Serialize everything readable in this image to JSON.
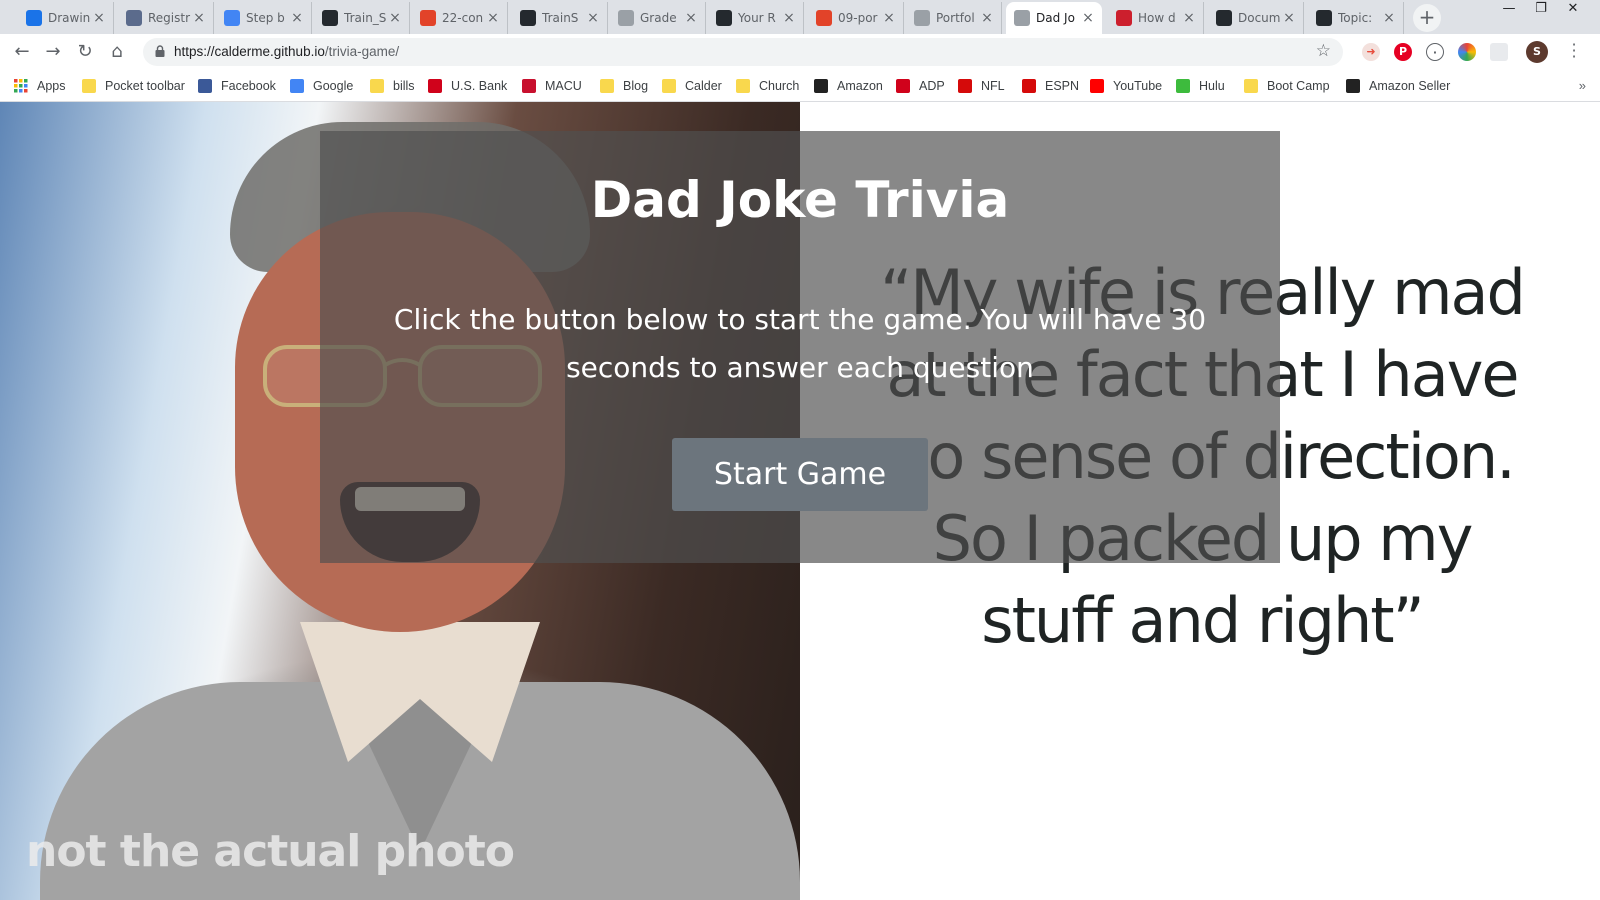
{
  "browser": {
    "tabs": [
      {
        "title": "Drawing",
        "icon": "loading-spinner-icon",
        "color": "#1a73e8"
      },
      {
        "title": "Registr",
        "icon": "form-icon",
        "color": "#5b6b8c"
      },
      {
        "title": "Step b",
        "icon": "google-docs-icon",
        "color": "#4285f4"
      },
      {
        "title": "Train_S",
        "icon": "github-icon",
        "color": "#24292e"
      },
      {
        "title": "22-con",
        "icon": "gitlab-icon",
        "color": "#e24329"
      },
      {
        "title": "TrainS",
        "icon": "github-icon",
        "color": "#24292e"
      },
      {
        "title": "Grade",
        "icon": "page-icon",
        "color": "#9aa0a6"
      },
      {
        "title": "Your R",
        "icon": "github-icon",
        "color": "#24292e"
      },
      {
        "title": "09-por",
        "icon": "gitlab-icon",
        "color": "#e24329"
      },
      {
        "title": "Portfol",
        "icon": "page-icon",
        "color": "#9aa0a6"
      },
      {
        "title": "Dad Jo",
        "icon": "page-icon",
        "color": "#9aa0a6",
        "active": true
      },
      {
        "title": "How d",
        "icon": "opera-icon",
        "color": "#cc1f2d"
      },
      {
        "title": "Docum",
        "icon": "github-icon",
        "color": "#24292e"
      },
      {
        "title": "Topic:",
        "icon": "github-icon",
        "color": "#24292e"
      }
    ],
    "new_tab_label": "+",
    "url_host": "https://calderme.github.io",
    "url_path": "/trivia-game/",
    "profile_initial": "S",
    "bookmarks": [
      {
        "label": "Apps",
        "icon": "apps-grid-icon",
        "color": "#5f6368"
      },
      {
        "label": "Pocket toolbar",
        "icon": "folder-icon",
        "color": "#f9d84d"
      },
      {
        "label": "Facebook",
        "icon": "facebook-icon",
        "color": "#3b5998"
      },
      {
        "label": "Google",
        "icon": "google-icon",
        "color": "#4285f4"
      },
      {
        "label": "bills",
        "icon": "folder-icon",
        "color": "#f9d84d"
      },
      {
        "label": "U.S. Bank",
        "icon": "shield-icon",
        "color": "#d0021b"
      },
      {
        "label": "MACU",
        "icon": "macu-icon",
        "color": "#c8102e"
      },
      {
        "label": "Blog",
        "icon": "folder-icon",
        "color": "#f9d84d"
      },
      {
        "label": "Calder",
        "icon": "folder-icon",
        "color": "#f9d84d"
      },
      {
        "label": "Church",
        "icon": "folder-icon",
        "color": "#f9d84d"
      },
      {
        "label": "Amazon",
        "icon": "amazon-icon",
        "color": "#222222"
      },
      {
        "label": "ADP",
        "icon": "adp-icon",
        "color": "#d0021b"
      },
      {
        "label": "NFL",
        "icon": "nfl-icon",
        "color": "#d50a0a"
      },
      {
        "label": "ESPN",
        "icon": "espn-icon",
        "color": "#d50a0a"
      },
      {
        "label": "YouTube",
        "icon": "youtube-icon",
        "color": "#ff0000"
      },
      {
        "label": "Hulu",
        "icon": "hulu-icon",
        "color": "#3dbb3d"
      },
      {
        "label": "Boot Camp",
        "icon": "folder-icon",
        "color": "#f9d84d"
      },
      {
        "label": "Amazon Seller",
        "icon": "amazon-icon",
        "color": "#222222"
      }
    ],
    "bookmarks_more": "»"
  },
  "page": {
    "title": "Dad Joke Trivia",
    "instructions": "Click the button below to start the game. You will have 30 seconds to answer each question",
    "start_button": "Start Game",
    "photo_caption": "not the actual photo",
    "quote": "“My wife is really mad at the fact that I have no sense of direction. So I packed up my stuff and right”",
    "button_color": "#6c757d",
    "overlay_color": "#505050"
  }
}
